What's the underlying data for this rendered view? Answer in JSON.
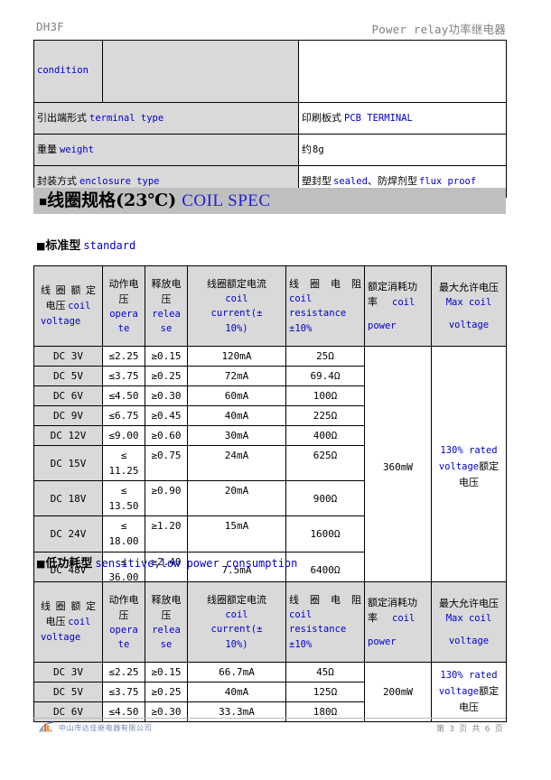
{
  "header": {
    "left_title": "DH3F",
    "right_title_en": "Power relay",
    "right_title_zh": "功率继电器"
  },
  "top_table": {
    "rows": [
      {
        "label_zh": "",
        "label_en": "condition",
        "mid": "",
        "value_zh": "",
        "value_en": "",
        "kind": "condition"
      },
      {
        "label_zh": "引出端形式",
        "label_en": "terminal type",
        "value_zh": "印刷板式",
        "value_en": "PCB TERMINAL"
      },
      {
        "label_zh": "重量",
        "label_en": "weight",
        "value_zh": "约",
        "value_en": "8g"
      },
      {
        "label_zh": "封装方式",
        "label_en": "enclosure type",
        "value_zh": "塑封型",
        "value_en": "sealed",
        "value_zh2": "、防焊剂型",
        "value_en2": "flux proof"
      }
    ]
  },
  "coil_section": {
    "marker": "■",
    "title_zh": "线圈规格(23℃)",
    "title_en": "COIL SPEC"
  },
  "standard": {
    "marker": "■",
    "sub_title_zh": "标准型",
    "sub_title_en": "standard",
    "headers": [
      {
        "zh": "线圈额定电压",
        "zh_a": "线 圈 额 定",
        "zh_b": "电压",
        "en": "coil voltage",
        "en_a": "coil",
        "en_b": "voltage"
      },
      {
        "zh_a": "动作电",
        "zh_b": "压",
        "en_a": "opera",
        "en_b": "te"
      },
      {
        "zh_a": "释放电",
        "zh_b": "压",
        "en_a": "relea",
        "en_b": "se"
      },
      {
        "zh_a": "线圈额定电流",
        "en_a": "coil",
        "en_b": "current(±",
        "en_c": "10%)"
      },
      {
        "zh_a": "线 圈 电 阻",
        "en_a": "coil",
        "en_b": "resistance",
        "en_c": "±10%"
      },
      {
        "zh_a": "额定消耗功",
        "zh_b": "率",
        "en_b": "coil",
        "en_c": "power"
      },
      {
        "zh_a": "最大允许电压",
        "en_a": "Max coil",
        "en_b": "voltage"
      }
    ],
    "rows": [
      {
        "voltage": "DC  3V",
        "operate": "≤2.25",
        "release": "≥0.15",
        "current": "120mA",
        "resistance": "25Ω"
      },
      {
        "voltage": "DC  5V",
        "operate": "≤3.75",
        "release": "≥0.25",
        "current": "72mA",
        "resistance": "69.4Ω"
      },
      {
        "voltage": "DC  6V",
        "operate": "≤4.50",
        "release": "≥0.30",
        "current": "60mA",
        "resistance": "100Ω"
      },
      {
        "voltage": "DC  9V",
        "operate": "≤6.75",
        "release": "≥0.45",
        "current": "40mA",
        "resistance": "225Ω"
      },
      {
        "voltage": "DC 12V",
        "operate": "≤9.00",
        "release": "≥0.60",
        "current": "30mA",
        "resistance": "400Ω"
      },
      {
        "voltage": "DC 15V",
        "operate": "≤ 11.25",
        "release": "≥0.75",
        "current": "24mA",
        "resistance": "625Ω"
      },
      {
        "voltage": "DC 18V",
        "operate": "≤ 13.50",
        "release": "≥0.90",
        "current": "20mA",
        "resistance": "900Ω"
      },
      {
        "voltage": "DC 24V",
        "operate": "≤ 18.00",
        "release": "≥1.20",
        "current": "15mA",
        "resistance": "1600Ω"
      },
      {
        "voltage": "DC 48V",
        "operate": "≤ 36.00",
        "release": "≥2.40",
        "current": "7.5mA",
        "resistance": "6400Ω"
      }
    ],
    "power": "360mW",
    "max_voltage_en": "130% rated voltage",
    "max_voltage_zh": "额定电压"
  },
  "sensitive": {
    "marker": "■",
    "sub_title_zh": "低功耗型",
    "sub_title_en": "sensitive,low power consumption",
    "rows": [
      {
        "voltage": "DC  3V",
        "operate": "≤2.25",
        "release": "≥0.15",
        "current": "66.7mA",
        "resistance": "45Ω"
      },
      {
        "voltage": "DC  5V",
        "operate": "≤3.75",
        "release": "≥0.25",
        "current": "40mA",
        "resistance": "125Ω"
      },
      {
        "voltage": "DC  6V",
        "operate": "≤4.50",
        "release": "≥0.30",
        "current": "33.3mA",
        "resistance": "180Ω"
      }
    ],
    "power": "200mW",
    "max_voltage_en": "130% rated voltage",
    "max_voltage_zh": "额定电压"
  },
  "footer": {
    "company": "中山市达佳继电器有限公司",
    "page": "第 3 页 共 6 页"
  },
  "colors": {
    "en_blue": "#0000cc",
    "shade_gray": "#d9d9d9",
    "bar_gray": "#bfbfbf",
    "header_gray": "#808080"
  }
}
